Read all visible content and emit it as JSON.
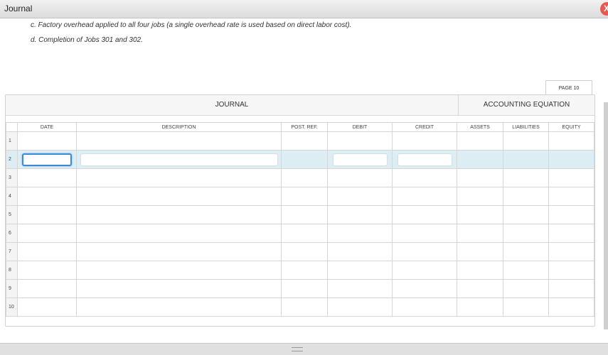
{
  "window": {
    "title": "Journal",
    "close_symbol": "X"
  },
  "instructions": [
    "c. Factory overhead applied to all four jobs (a single overhead rate is used based on direct labor cost).",
    "d. Completion of Jobs 301 and 302."
  ],
  "page_tab": "PAGE 10",
  "headers": {
    "journal": "JOURNAL",
    "accounting_equation": "ACCOUNTING EQUATION"
  },
  "columns": {
    "date": "DATE",
    "description": "DESCRIPTION",
    "post_ref": "POST. REF.",
    "debit": "DEBIT",
    "credit": "CREDIT",
    "assets": "ASSETS",
    "liabilities": "LIABILITIES",
    "equity": "EQUITY"
  },
  "rows": [
    "1",
    "2",
    "3",
    "4",
    "5",
    "6",
    "7",
    "8",
    "9",
    "10"
  ],
  "active_row": 2
}
